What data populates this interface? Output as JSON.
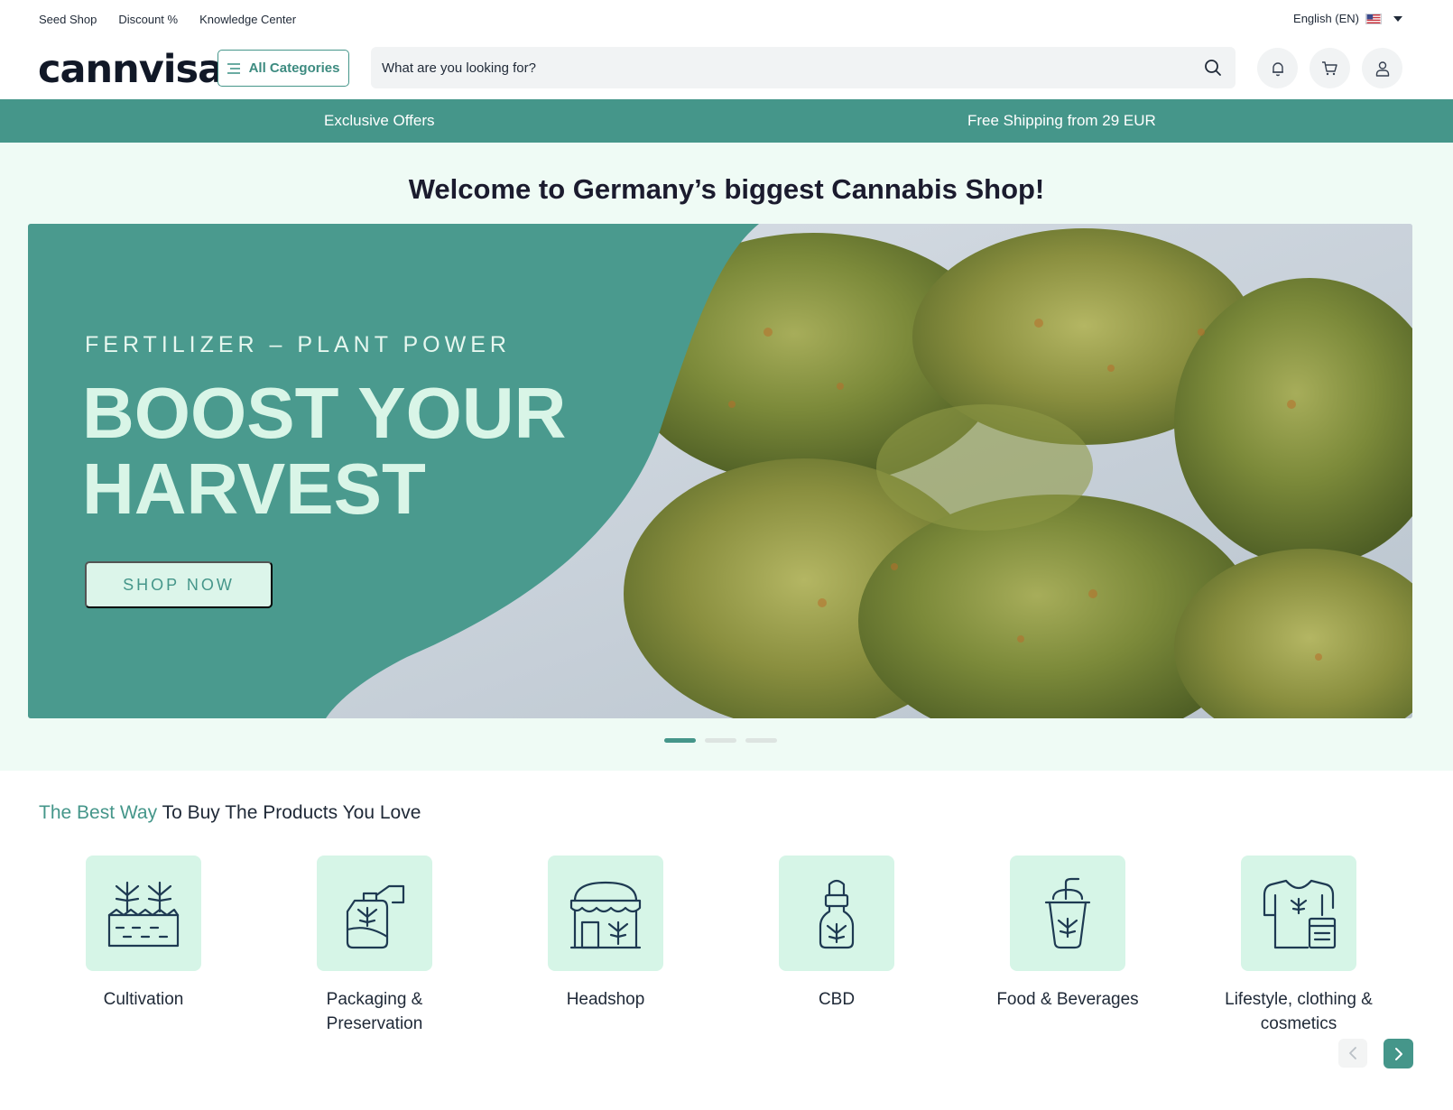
{
  "utility_nav": {
    "links": [
      "Seed Shop",
      "Discount %",
      "Knowledge Center"
    ],
    "language": "English (EN)"
  },
  "header": {
    "logo": "cannvisa",
    "all_categories": "All Categories",
    "search_placeholder": "What are you looking for?",
    "icons": [
      "bell-icon",
      "cart-icon",
      "user-icon"
    ]
  },
  "promo_bar": {
    "left": "Exclusive Offers",
    "right": "Free Shipping from 29 EUR"
  },
  "hero": {
    "welcome": "Welcome to Germany’s biggest Cannabis Shop!",
    "banner": {
      "eyebrow": "FERTILIZER – PLANT POWER",
      "headline_line1": "BOOST YOUR",
      "headline_line2": "HARVEST",
      "cta": "SHOP NOW"
    },
    "slides_total": 3,
    "slide_active": 1
  },
  "categories": {
    "title_accent": "The Best Way",
    "title_rest": "To Buy The Products You Love",
    "items": [
      {
        "label": "Cultivation",
        "icon": "cultivation-icon"
      },
      {
        "label": "Packaging & Preservation",
        "icon": "packaging-icon"
      },
      {
        "label": "Headshop",
        "icon": "headshop-icon"
      },
      {
        "label": "CBD",
        "icon": "cbd-dropper-icon"
      },
      {
        "label": "Food & Beverages",
        "icon": "drink-cup-icon"
      },
      {
        "label": "Lifestyle, clothing & cosmetics",
        "icon": "clothing-icon"
      }
    ]
  },
  "colors": {
    "brand_teal": "#45968a",
    "mint_background": "#effbf5",
    "tile_mint": "#d6f5e7",
    "icon_navy": "#1e3a52"
  }
}
